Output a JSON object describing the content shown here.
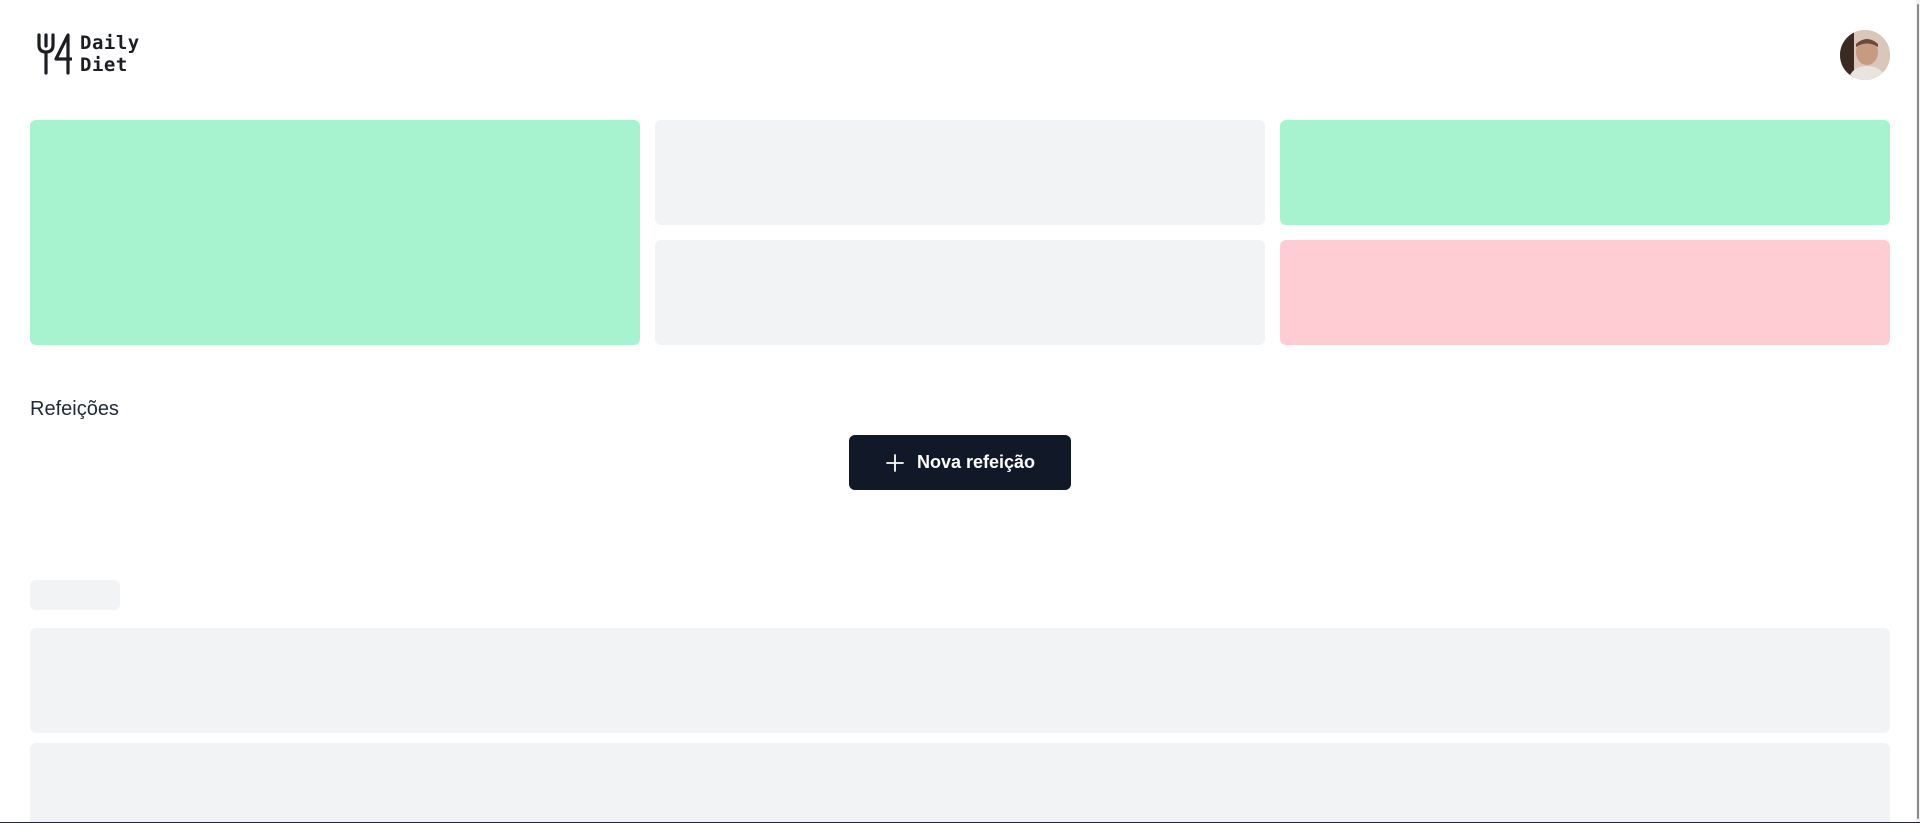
{
  "header": {
    "logo": {
      "icon": "fork-and-four-logo-icon",
      "line1": "Daily",
      "line2": "Diet"
    },
    "avatar": {
      "icon": "user-avatar"
    }
  },
  "stats": {
    "cards": [
      {
        "state": "loading",
        "color": "#a7f3d0"
      },
      {
        "state": "loading",
        "color": "#f2f3f5"
      },
      {
        "state": "loading",
        "color": "#f2f3f5"
      },
      {
        "state": "loading",
        "color": "#a7f3d0"
      },
      {
        "state": "loading",
        "color": "#fecdd3"
      }
    ]
  },
  "meals": {
    "title": "Refeições",
    "new_meal_button": {
      "label": "Nova refeição",
      "icon": "plus-icon"
    },
    "skeleton_rows": 2
  },
  "colors": {
    "accent_dark": "#111827",
    "success": "#a7f3d0",
    "danger": "#fecdd3",
    "skeleton": "#f2f3f5"
  }
}
